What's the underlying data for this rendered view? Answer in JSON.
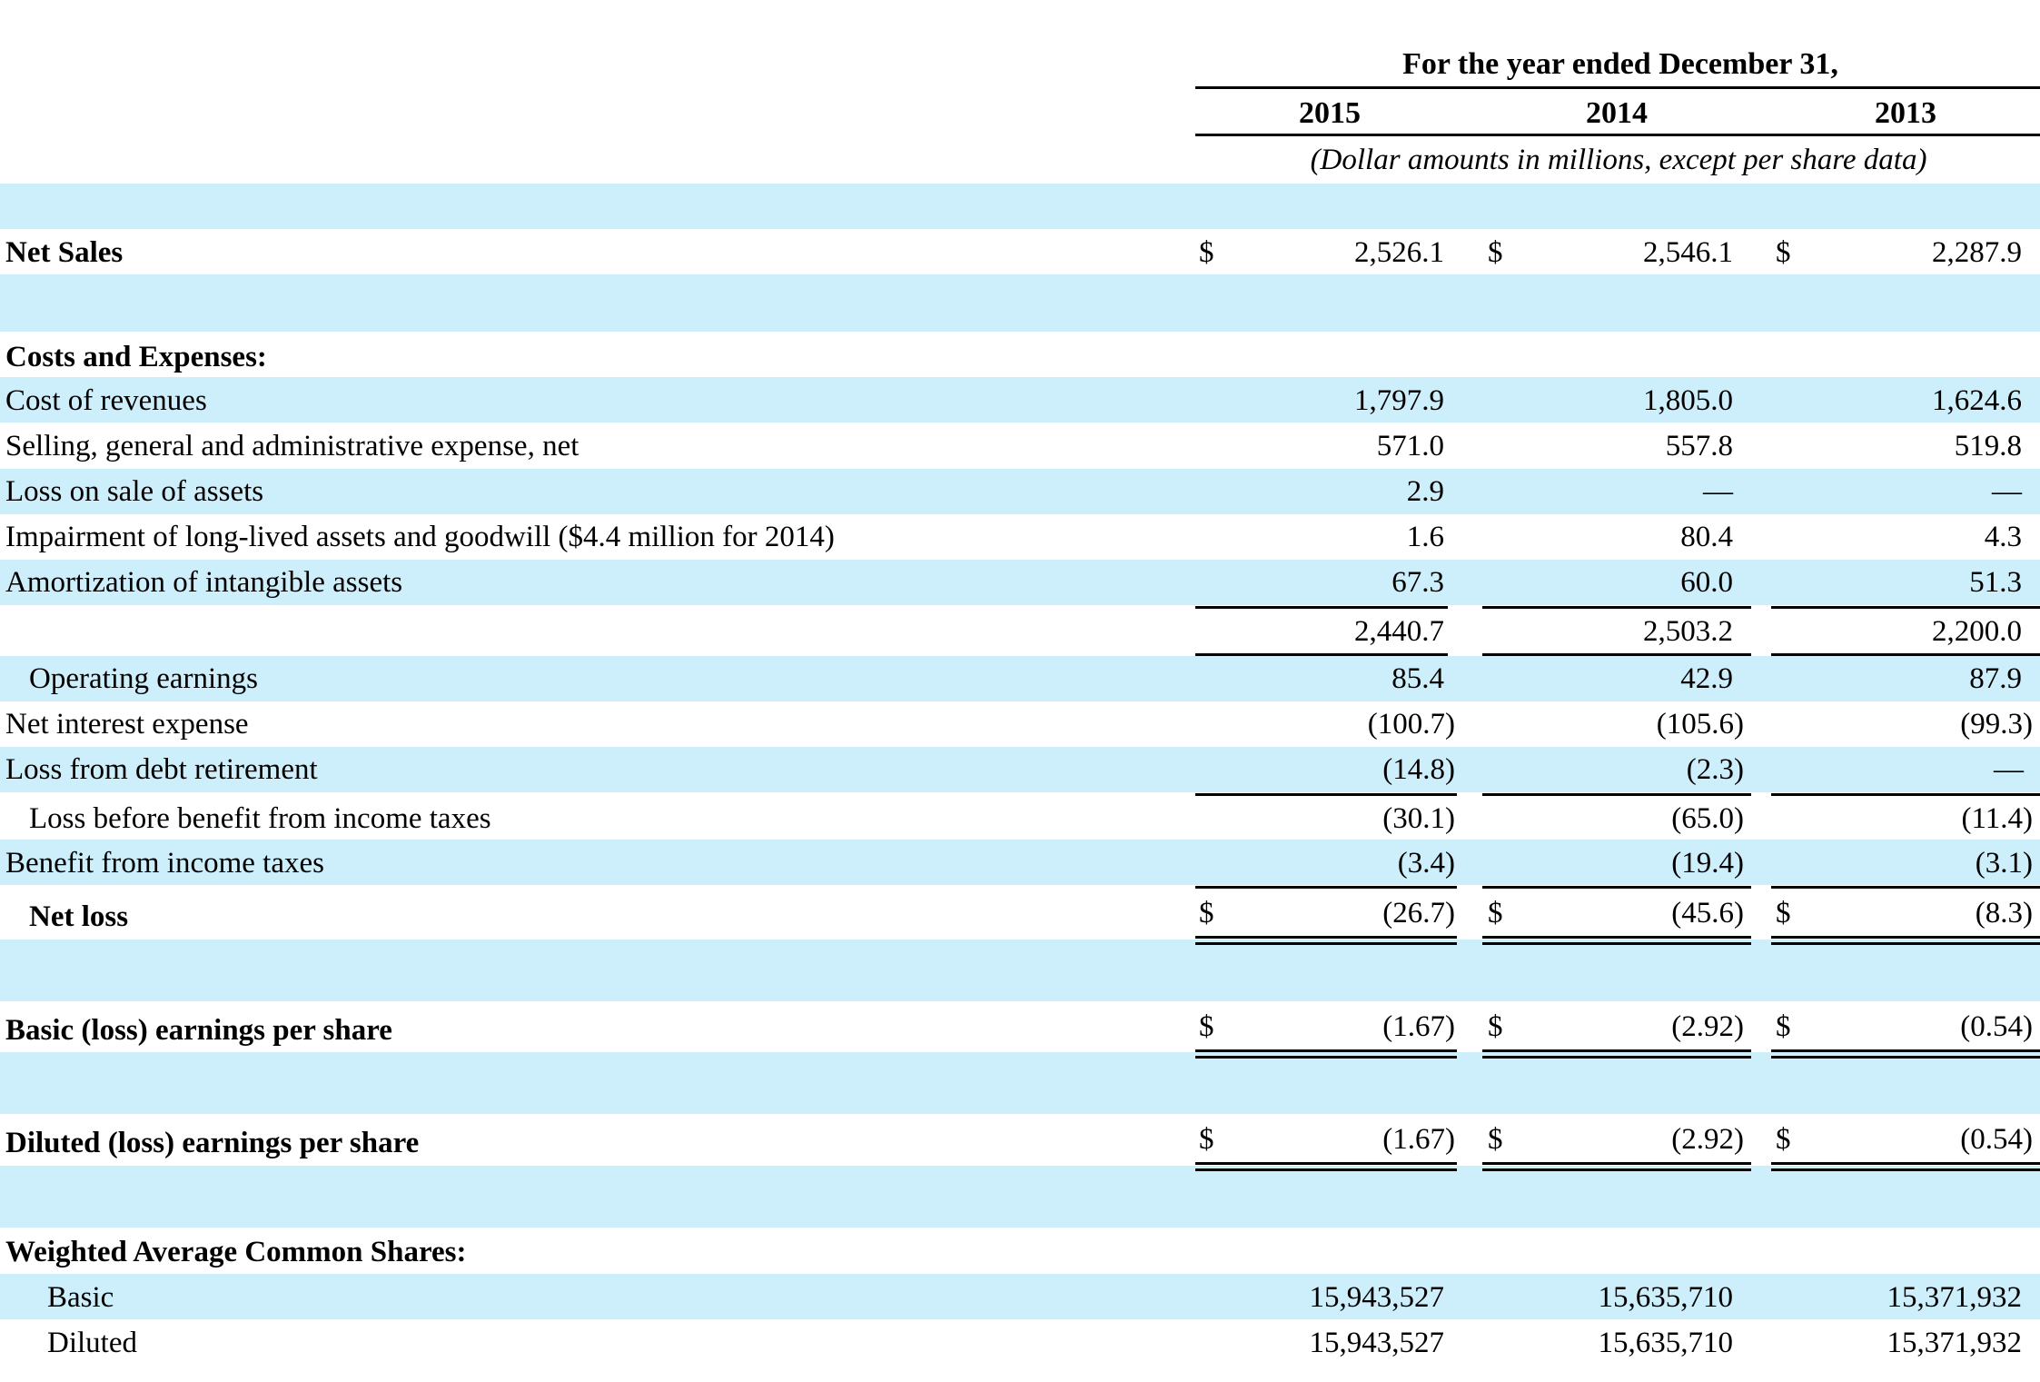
{
  "header": {
    "period": "For the year ended December 31,",
    "years": [
      "2015",
      "2014",
      "2013"
    ],
    "unit_note": "(Dollar amounts in millions, except per share data)"
  },
  "rows": {
    "net_sales": {
      "label": "Net Sales",
      "currency": "$",
      "values": [
        "2,526.1",
        "2,546.1",
        "2,287.9"
      ]
    },
    "costs_heading": {
      "label": "Costs and Expenses:"
    },
    "cost_of_revenues": {
      "label": "Cost of revenues",
      "values": [
        "1,797.9",
        "1,805.0",
        "1,624.6"
      ]
    },
    "sga": {
      "label": "Selling, general and administrative expense, net",
      "values": [
        "571.0",
        "557.8",
        "519.8"
      ]
    },
    "loss_sale_assets": {
      "label": "Loss on sale of assets",
      "values": [
        "2.9",
        "—",
        "—"
      ]
    },
    "impairment": {
      "label": "Impairment of long-lived assets and goodwill ($4.4 million for 2014)",
      "values": [
        "1.6",
        "80.4",
        "4.3"
      ]
    },
    "amortization": {
      "label": "Amortization of intangible assets",
      "values": [
        "67.3",
        "60.0",
        "51.3"
      ]
    },
    "total_costs": {
      "values": [
        "2,440.7",
        "2,503.2",
        "2,200.0"
      ]
    },
    "operating_earnings": {
      "label": "Operating earnings",
      "values": [
        "85.4",
        "42.9",
        "87.9"
      ]
    },
    "net_interest": {
      "label": "Net interest expense",
      "values": [
        "(100.7)",
        "(105.6)",
        "(99.3)"
      ]
    },
    "debt_retirement": {
      "label": "Loss from debt retirement",
      "values": [
        "(14.8)",
        "(2.3)",
        "—"
      ]
    },
    "loss_before_taxes": {
      "label": "Loss before benefit from income taxes",
      "values": [
        "(30.1)",
        "(65.0)",
        "(11.4)"
      ]
    },
    "benefit_taxes": {
      "label": "Benefit from income taxes",
      "values": [
        "(3.4)",
        "(19.4)",
        "(3.1)"
      ]
    },
    "net_loss": {
      "label": "Net loss",
      "currency": "$",
      "values": [
        "(26.7)",
        "(45.6)",
        "(8.3)"
      ]
    },
    "basic_eps": {
      "label": "Basic (loss) earnings per share",
      "currency": "$",
      "values": [
        "(1.67)",
        "(2.92)",
        "(0.54)"
      ]
    },
    "diluted_eps": {
      "label": "Diluted (loss) earnings per share",
      "currency": "$",
      "values": [
        "(1.67)",
        "(2.92)",
        "(0.54)"
      ]
    },
    "wa_heading": {
      "label": "Weighted Average Common Shares:"
    },
    "wa_basic": {
      "label": "Basic",
      "values": [
        "15,943,527",
        "15,635,710",
        "15,371,932"
      ]
    },
    "wa_diluted": {
      "label": "Diluted",
      "values": [
        "15,943,527",
        "15,635,710",
        "15,371,932"
      ]
    }
  }
}
